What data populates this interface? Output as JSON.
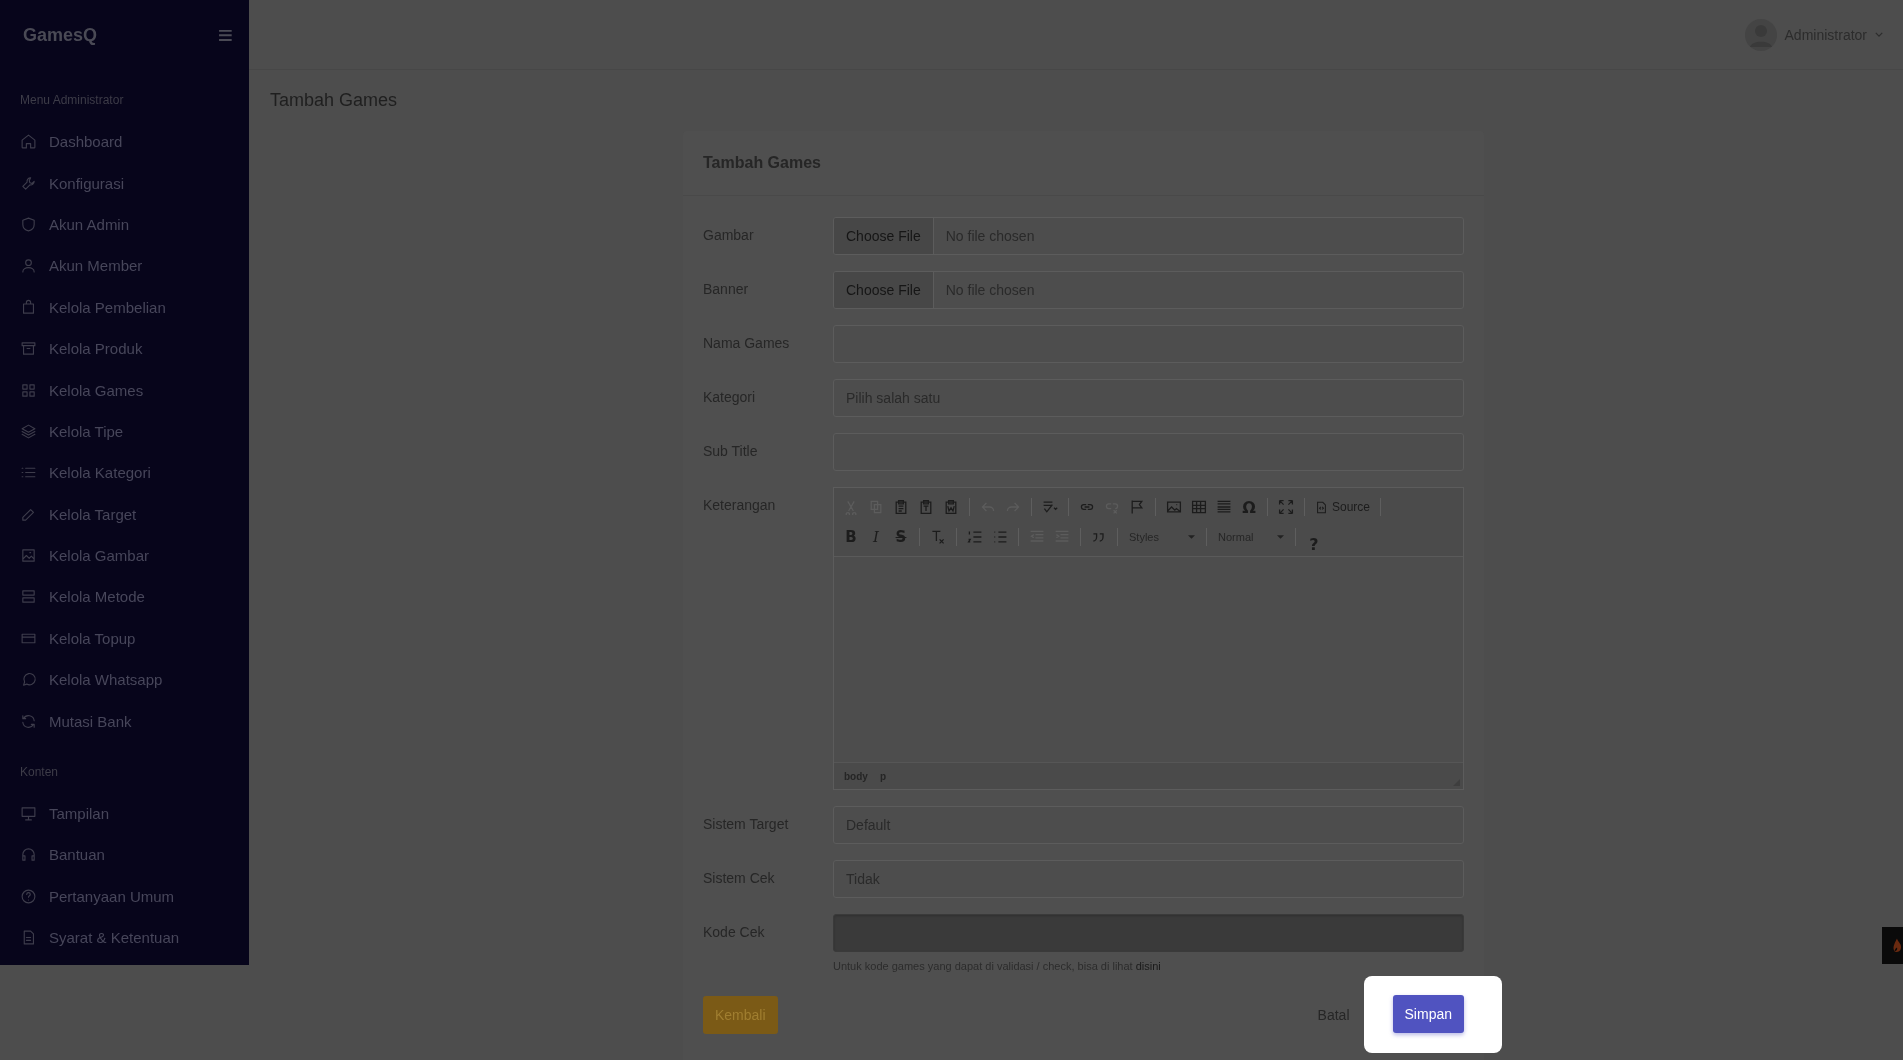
{
  "sidebar": {
    "brand": "GamesQ",
    "menu_glyph": "≡",
    "sections": [
      {
        "label": "Menu Administrator",
        "items": [
          {
            "label": "Dashboard"
          },
          {
            "label": "Konfigurasi"
          },
          {
            "label": "Akun Admin"
          },
          {
            "label": "Akun Member"
          },
          {
            "label": "Kelola Pembelian"
          },
          {
            "label": "Kelola Produk"
          },
          {
            "label": "Kelola Games"
          },
          {
            "label": "Kelola Tipe"
          },
          {
            "label": "Kelola Kategori"
          },
          {
            "label": "Kelola Target"
          },
          {
            "label": "Kelola Gambar"
          },
          {
            "label": "Kelola Metode"
          },
          {
            "label": "Kelola Topup"
          },
          {
            "label": "Kelola Whatsapp"
          },
          {
            "label": "Mutasi Bank"
          }
        ]
      },
      {
        "label": "Konten",
        "items": [
          {
            "label": "Tampilan"
          },
          {
            "label": "Bantuan"
          },
          {
            "label": "Pertanyaan Umum"
          },
          {
            "label": "Syarat & Ketentuan"
          }
        ]
      }
    ]
  },
  "topbar": {
    "user": "Administrator"
  },
  "page_title": "Tambah Games",
  "card": {
    "title": "Tambah Games",
    "fields": [
      {
        "kind": "file",
        "label": "Gambar",
        "button": "Choose File",
        "status": "No file chosen"
      },
      {
        "kind": "file",
        "label": "Banner",
        "button": "Choose File",
        "status": "No file chosen"
      },
      {
        "kind": "text",
        "label": "Nama Games",
        "disabled": false
      },
      {
        "kind": "select",
        "label": "Kategori",
        "value": "Pilih salah satu"
      },
      {
        "kind": "text",
        "label": "Sub Title",
        "disabled": false
      },
      {
        "kind": "editor",
        "label": "Keterangan",
        "path": [
          "body",
          "p"
        ],
        "toolbar": [
          [
            {
              "kind": "cut",
              "disabled": true
            },
            {
              "kind": "copy",
              "disabled": true
            },
            {
              "kind": "paste",
              "disabled": false
            },
            {
              "kind": "paste-text",
              "disabled": false
            },
            {
              "kind": "paste-word",
              "disabled": false
            },
            {
              "kind": "separator"
            },
            {
              "kind": "undo",
              "disabled": true
            },
            {
              "kind": "redo",
              "disabled": true
            },
            {
              "kind": "separator"
            },
            {
              "kind": "spellcheck",
              "disabled": false
            },
            {
              "kind": "separator"
            },
            {
              "kind": "link",
              "disabled": false
            },
            {
              "kind": "unlink",
              "disabled": true
            },
            {
              "kind": "flag",
              "disabled": false
            },
            {
              "kind": "separator"
            },
            {
              "kind": "image",
              "disabled": false
            },
            {
              "kind": "table",
              "disabled": false
            },
            {
              "kind": "hrule",
              "disabled": false
            },
            {
              "kind": "symbol",
              "text": "Ω",
              "disabled": false
            },
            {
              "kind": "separator"
            },
            {
              "kind": "maximize",
              "disabled": false
            },
            {
              "kind": "separator"
            },
            {
              "kind": "source",
              "text": "Source",
              "disabled": false
            },
            {
              "kind": "separator"
            }
          ],
          [
            {
              "kind": "bold",
              "text": "B",
              "disabled": false
            },
            {
              "kind": "italic",
              "text": "I",
              "disabled": false
            },
            {
              "kind": "strike",
              "text": "S",
              "disabled": false
            },
            {
              "kind": "separator"
            },
            {
              "kind": "clear-format",
              "disabled": false
            },
            {
              "kind": "separator"
            },
            {
              "kind": "numbered-list",
              "disabled": false
            },
            {
              "kind": "bulleted-list",
              "disabled": false
            },
            {
              "kind": "separator"
            },
            {
              "kind": "outdent",
              "disabled": true
            },
            {
              "kind": "indent",
              "disabled": true
            },
            {
              "kind": "separator"
            },
            {
              "kind": "quote",
              "disabled": false
            },
            {
              "kind": "separator"
            },
            {
              "kind": "combo",
              "text": "Styles",
              "disabled": false
            },
            {
              "kind": "separator"
            },
            {
              "kind": "combo",
              "text": "Normal",
              "disabled": false
            },
            {
              "kind": "separator"
            },
            {
              "kind": "help",
              "text": "?",
              "disabled": false
            }
          ]
        ]
      },
      {
        "kind": "select",
        "label": "Sistem Target",
        "value": "Default"
      },
      {
        "kind": "select",
        "label": "Sistem Cek",
        "value": "Tidak"
      },
      {
        "kind": "text",
        "label": "Kode Cek",
        "disabled": true,
        "help": "Untuk kode games yang dapat di validasi / check, bisa di lihat",
        "help_link": "disini"
      }
    ],
    "back_button": "Kembali",
    "cancel_link": "Batal",
    "save_button": "Simpan"
  }
}
